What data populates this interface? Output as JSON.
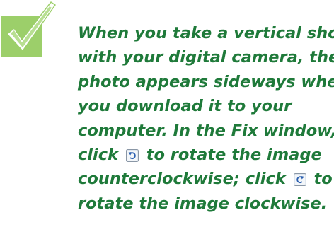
{
  "tip": {
    "lines": [
      "When you take a vertical shot",
      "with your digital camera, the",
      "photo appears sideways when",
      "you download it to your",
      "computer. In the Fix window,"
    ],
    "line6_before": "click",
    "line6_after": "to rotate the image",
    "line7_before": "counterclockwise; click",
    "line7_after": "to",
    "line8": "rotate the image clockwise."
  },
  "icons": {
    "tip_marker": "checkmark-box-icon",
    "rotate_ccw": "rotate-counterclockwise-icon",
    "rotate_cw": "rotate-clockwise-icon"
  },
  "colors": {
    "text": "#1f7a3a",
    "check_box": "#9ccf6a",
    "check_mark": "#ffffff"
  }
}
